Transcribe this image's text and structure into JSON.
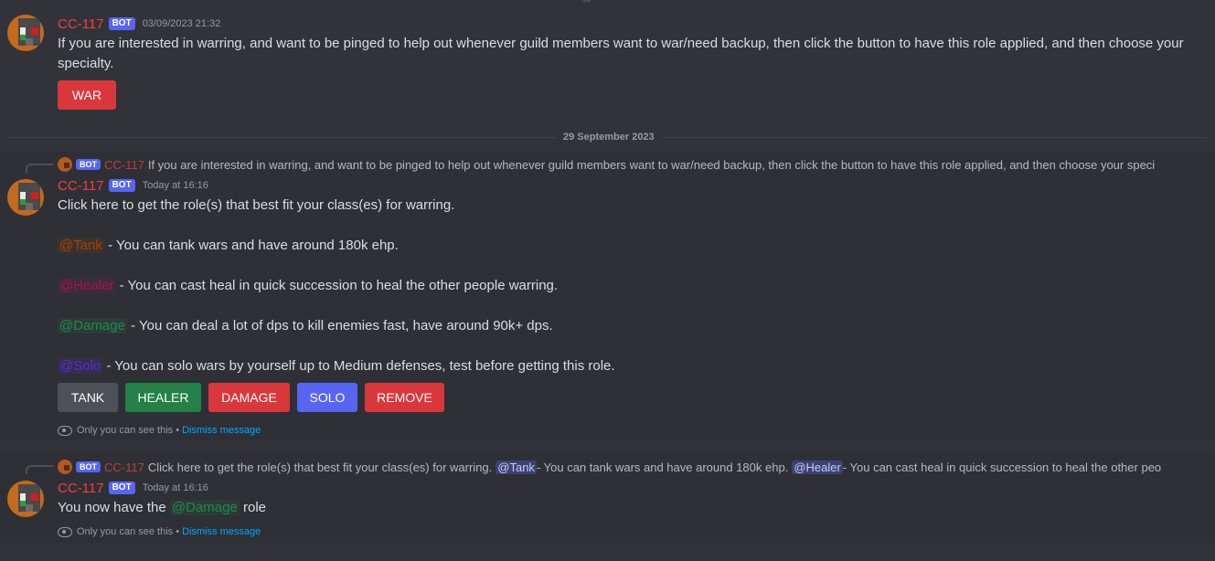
{
  "bot": {
    "username": "CC-117",
    "tag": "BOT"
  },
  "messages": [
    {
      "timestamp": "03/09/2023 21:32",
      "text": "If you are interested in warring, and want to be pinged to help out whenever guild members want to war/need backup, then click the button to have this role applied, and then choose your specialty.",
      "button": "WAR"
    }
  ],
  "divider": {
    "date": "29 September 2023"
  },
  "message2": {
    "reply": {
      "text": "If you are interested in warring, and want to be pinged to help out whenever guild members want to war/need backup, then click the button to have this role applied, and then choose your speci"
    },
    "timestamp": "Today at 16:16",
    "intro": "Click here to get the role(s) that best fit your class(es) for warring.",
    "roles": [
      {
        "mention": "@Tank",
        "desc": " - You can tank wars and have around 180k ehp."
      },
      {
        "mention": "@Healer",
        "desc": " - You can cast heal in quick succession to heal the other people warring."
      },
      {
        "mention": "@Damage",
        "desc": " - You can deal a lot of dps to kill enemies fast, have around 90k+ dps."
      },
      {
        "mention": "@Solo",
        "desc": " - You can solo wars by yourself up to Medium defenses, test before getting this role."
      }
    ],
    "buttons": [
      "TANK",
      "HEALER",
      "DAMAGE",
      "SOLO",
      "REMOVE"
    ],
    "note": "Only you can see this •",
    "dismiss": "Dismiss message"
  },
  "message3": {
    "reply": {
      "text1": "Click here to get the role(s) that best fit your class(es) for warring.",
      "mention1": "@Tank",
      "text2": " - You can tank wars and have around 180k ehp.",
      "mention2": "@Healer",
      "text3": " - You can cast heal in quick succession to heal the other peo"
    },
    "timestamp": "Today at 16:16",
    "text_before": "You now have the",
    "mention": "@Damage",
    "text_after": "role",
    "note": "Only you can see this •",
    "dismiss": "Dismiss message"
  },
  "colors": {
    "background": "#313338",
    "username": "#f23f43",
    "bot_tag": "#5865f2",
    "button_red": "#da373c",
    "button_grey": "#4e5058",
    "button_green": "#248046",
    "button_blurple": "#5865f2",
    "link": "#00a8fc"
  }
}
